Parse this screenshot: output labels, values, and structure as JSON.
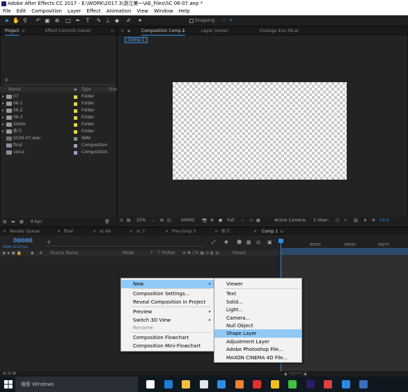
{
  "window": {
    "title": "Adobe After Effects CC 2017 - E:\\WORK\\2017.3\\浙江美一\\AE_Files\\SC 06-07.aep *"
  },
  "menubar": [
    "File",
    "Edit",
    "Composition",
    "Layer",
    "Effect",
    "Animation",
    "View",
    "Window",
    "Help"
  ],
  "toolbar": {
    "snapping_label": "Snapping"
  },
  "project_panel": {
    "tabs": [
      "Project",
      "Effect Controls (none)"
    ],
    "search_icon": "search-icon",
    "columns": {
      "name": "Name",
      "type": "Type",
      "size": "Size"
    },
    "items": [
      {
        "name": "07",
        "type": "Folder",
        "kind": "folder",
        "label_color": "#e3d64a"
      },
      {
        "name": "06-1",
        "type": "Folder",
        "kind": "folder",
        "label_color": "#e3d64a"
      },
      {
        "name": "06-2",
        "type": "Folder",
        "kind": "folder",
        "label_color": "#e3d64a"
      },
      {
        "name": "06-3",
        "type": "Folder",
        "kind": "folder",
        "label_color": "#e3d64a"
      },
      {
        "name": "Solids",
        "type": "Folder",
        "kind": "folder",
        "label_color": "#e3d64a"
      },
      {
        "name": "练习",
        "type": "Folder",
        "kind": "folder",
        "label_color": "#e3d64a"
      },
      {
        "name": "SC06-07.wav",
        "type": "WAV",
        "kind": "wav",
        "label_color": "#7a9a7a"
      },
      {
        "name": "final",
        "type": "Composition",
        "kind": "comp",
        "label_color": "#a0a0c8"
      },
      {
        "name": "voice",
        "type": "Composition",
        "kind": "comp",
        "label_color": "#a0a0c8"
      }
    ],
    "footer_bpc": "8 bpc"
  },
  "viewer_panel": {
    "tabs": [
      "Composition Comp 1",
      "Layer (none)",
      "Footage 4/sc-06.ai"
    ],
    "breadcrumb": "Comp 1",
    "zoom": "25%",
    "timecode": "00000",
    "resolution": "Full",
    "camera": "Active Camera",
    "views": "1 View",
    "exposure": "+0.0"
  },
  "timeline_panel": {
    "tabs": [
      "Render Queue",
      "final",
      "sc-06",
      "sc 7",
      "Pre-comp 3",
      "练习",
      "Comp 1"
    ],
    "timecode": "00000",
    "timecode_sub": "00000 (30.00 fps)",
    "columns": {
      "source_name": "Source Name",
      "mode": "Mode",
      "trkmat": "T TrkMat",
      "parent": "Parent"
    },
    "ruler_labels": [
      "00025",
      "00050",
      "00075"
    ]
  },
  "context_menu": {
    "items": [
      {
        "label": "New",
        "highlight": true,
        "submenu": true
      },
      {
        "separator": true
      },
      {
        "label": "Composition Settings..."
      },
      {
        "label": "Reveal Composition in Project"
      },
      {
        "separator": true
      },
      {
        "label": "Preview",
        "submenu": true
      },
      {
        "label": "Switch 3D View",
        "submenu": true
      },
      {
        "label": "Rename",
        "disabled": true
      },
      {
        "separator": true
      },
      {
        "label": "Composition Flowchart"
      },
      {
        "label": "Composition Mini-Flowchart"
      }
    ]
  },
  "submenu": {
    "items": [
      {
        "label": "Viewer"
      },
      {
        "separator": true
      },
      {
        "label": "Text"
      },
      {
        "label": "Solid..."
      },
      {
        "label": "Light..."
      },
      {
        "label": "Camera..."
      },
      {
        "label": "Null Object"
      },
      {
        "label": "Shape Layer",
        "highlight": true
      },
      {
        "label": "Adjustment Layer"
      },
      {
        "label": "Adobe Photoshop File..."
      },
      {
        "label": "MAXON CINEMA 4D File..."
      }
    ]
  },
  "taskbar": {
    "search_placeholder": "搜索 Windows",
    "apps": [
      {
        "name": "task-view-icon",
        "color": "#ffffff"
      },
      {
        "name": "edge-icon",
        "color": "#1e7fd8"
      },
      {
        "name": "file-explorer-icon",
        "color": "#f0c040"
      },
      {
        "name": "store-icon",
        "color": "#e6e6e6"
      },
      {
        "name": "ie-icon",
        "color": "#2b8ee0"
      },
      {
        "name": "app-orange-icon",
        "color": "#f08030"
      },
      {
        "name": "app-red-icon",
        "color": "#e03030"
      },
      {
        "name": "app-yellow-icon",
        "color": "#f0c020"
      },
      {
        "name": "wechat-icon",
        "color": "#40c040"
      },
      {
        "name": "after-effects-icon",
        "color": "#2b1b63"
      },
      {
        "name": "app-red2-icon",
        "color": "#e04040"
      },
      {
        "name": "app-blue-icon",
        "color": "#2a8ae0"
      },
      {
        "name": "app-word-icon",
        "color": "#3a6ec0"
      }
    ]
  }
}
